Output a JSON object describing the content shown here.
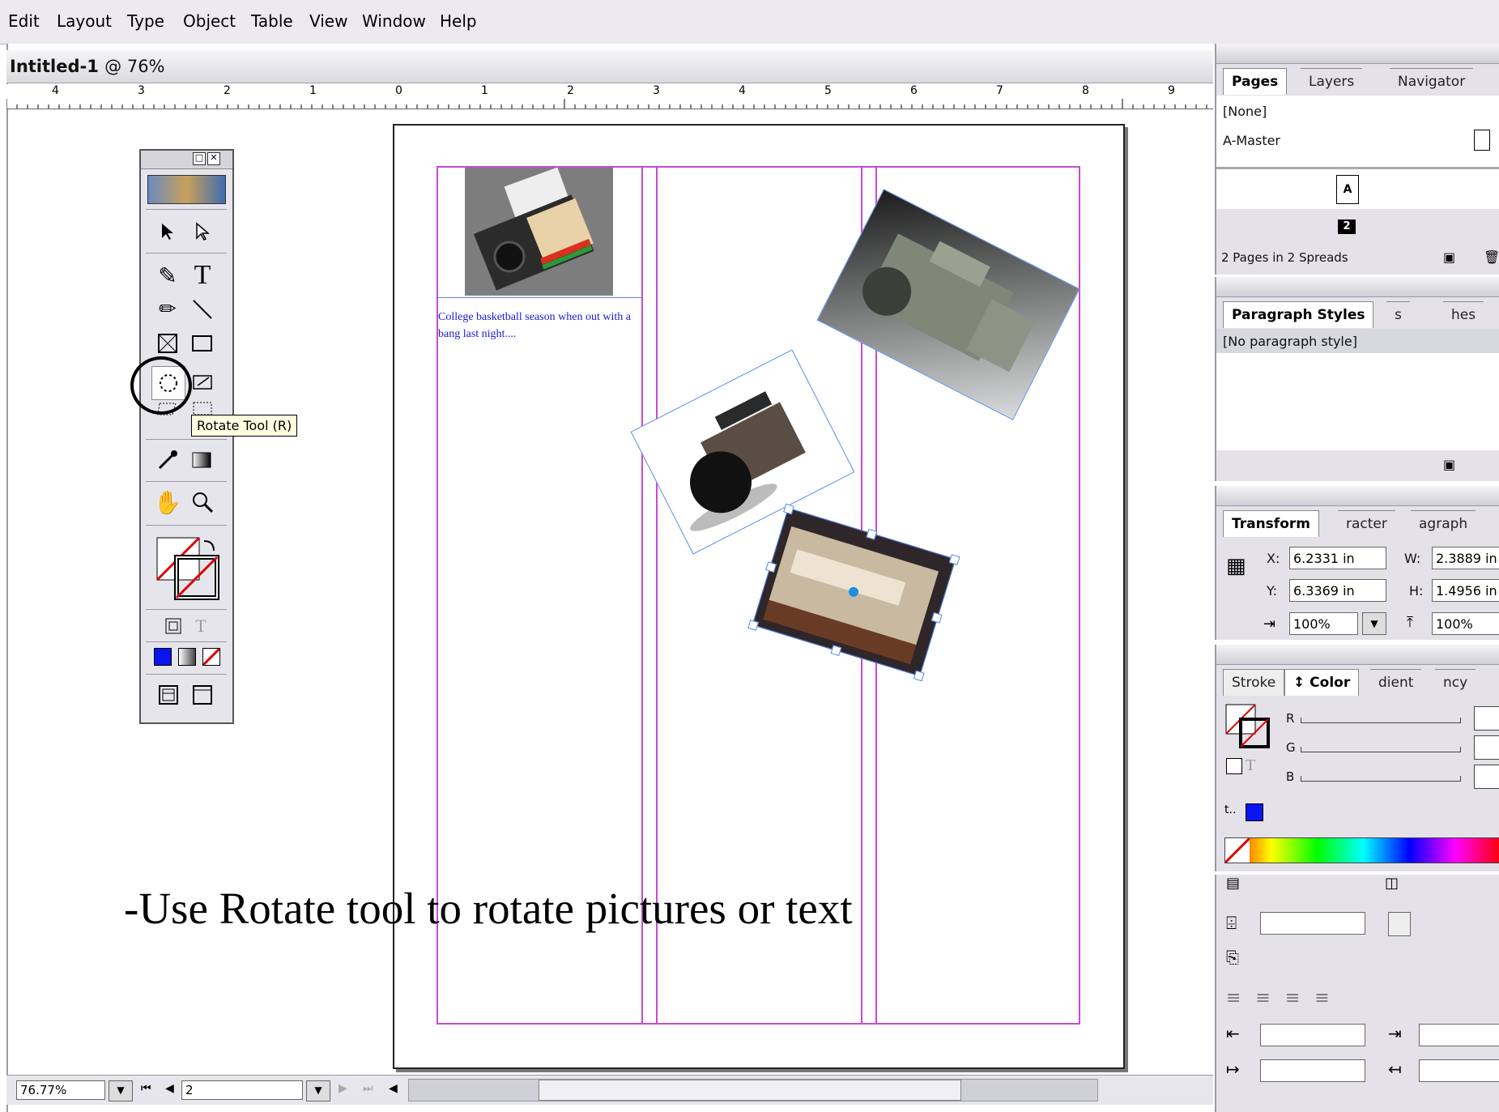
{
  "menu": [
    "Edit",
    "Layout",
    "Type",
    "Object",
    "Table",
    "View",
    "Window",
    "Help"
  ],
  "document": {
    "title": "Intitled-1",
    "zoom_label": "@ 76%",
    "ruler_labels": [
      "4",
      "3",
      "2",
      "1",
      "0",
      "1",
      "2",
      "3",
      "4",
      "5",
      "6",
      "7",
      "8",
      "9"
    ]
  },
  "page_content": {
    "text_frame": "College basketball season when out with a bang last night...."
  },
  "tooltip": "Rotate Tool (R)",
  "pages_panel": {
    "tabs": [
      "Pages",
      "Layers",
      "Navigator"
    ],
    "items": [
      "[None]",
      "A-Master"
    ],
    "page_badge_letter": "A",
    "page_number": "2",
    "footer": "2 Pages in 2 Spreads"
  },
  "paragraph_panel": {
    "tabs": [
      "Paragraph Styles",
      "s",
      "hes"
    ],
    "items": [
      "[No paragraph style]"
    ]
  },
  "transform_panel": {
    "tabs": [
      "Transform",
      "racter",
      "agraph"
    ],
    "x_label": "X:",
    "x_value": "6.2331 in",
    "y_label": "Y:",
    "y_value": "6.3369 in",
    "w_label": "W:",
    "w_value": "2.3889 in",
    "h_label": "H:",
    "h_value": "1.4956 in",
    "scale_x": "100%",
    "scale_y": "100%"
  },
  "color_panel": {
    "tabs": [
      "Stroke",
      "Color",
      "dient",
      "ncy"
    ],
    "channels": [
      "R",
      "G",
      "B"
    ],
    "fill_color": "#0a14f0"
  },
  "status": {
    "zoom": "76.77%",
    "page": "2"
  },
  "caption": "-Use Rotate tool to rotate pictures or text"
}
